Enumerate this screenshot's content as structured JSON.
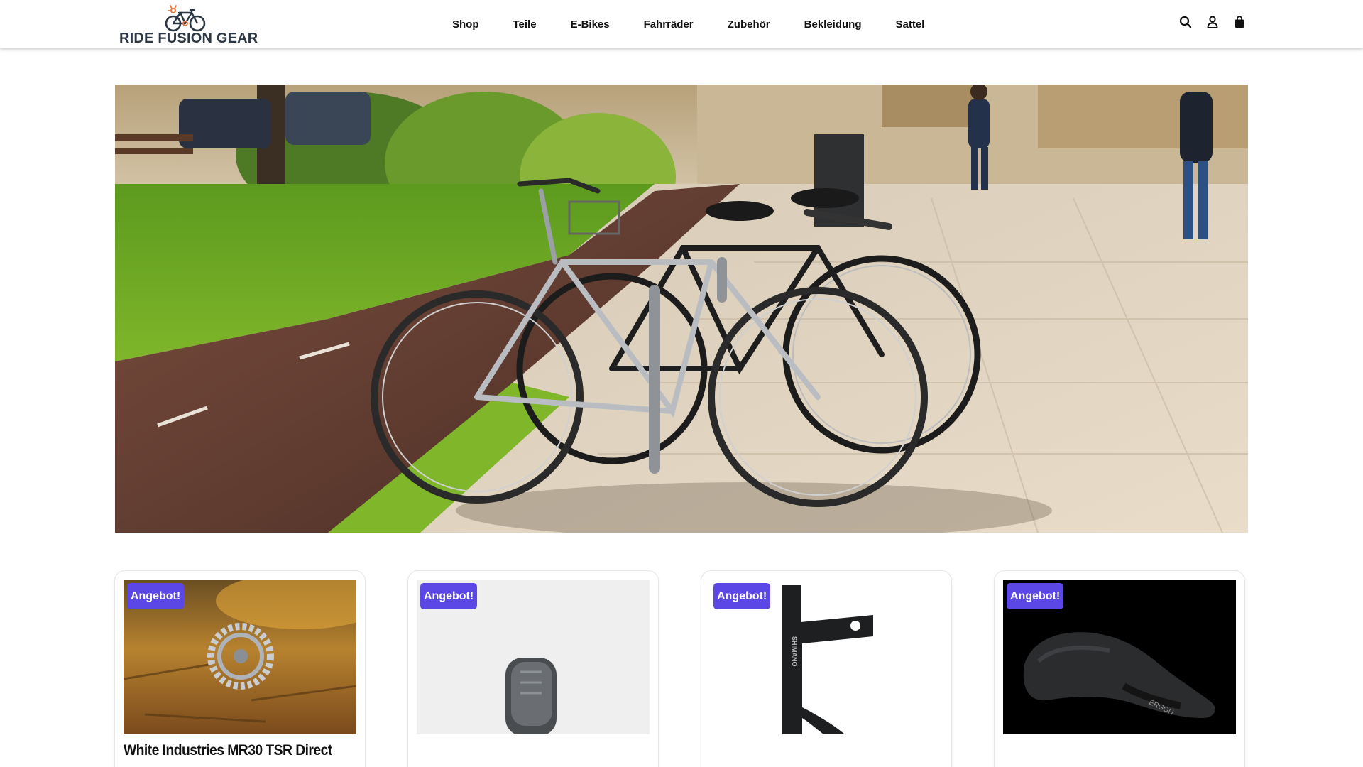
{
  "brand": {
    "name": "RIDE FUSION GEAR",
    "logo_icon": "bicycle-logo-icon"
  },
  "nav": {
    "items": [
      {
        "label": "Shop"
      },
      {
        "label": "Teile"
      },
      {
        "label": "E-Bikes"
      },
      {
        "label": "Fahrräder"
      },
      {
        "label": "Zubehör"
      },
      {
        "label": "Bekleidung"
      },
      {
        "label": "Sattel"
      }
    ]
  },
  "header_icons": [
    "search-icon",
    "user-icon",
    "cart-bag-icon"
  ],
  "hero": {
    "image": "bicycles-parked-at-city-bike-rack"
  },
  "products": [
    {
      "badge": "Angebot!",
      "title": "White Industries MR30 TSR Direct",
      "image": "chainring-on-autumn-leaves"
    },
    {
      "badge": "Angebot!",
      "title": "",
      "image": "grey-bike-light-sensor"
    },
    {
      "badge": "Angebot!",
      "title": "",
      "image": "shimano-disc-brake-adapter"
    },
    {
      "badge": "Angebot!",
      "title": "",
      "image": "ergon-black-saddle"
    }
  ],
  "colors": {
    "badge": "#5b46e6",
    "text": "#111111",
    "logo": "#2c3744",
    "logo_accent": "#e8743b"
  }
}
